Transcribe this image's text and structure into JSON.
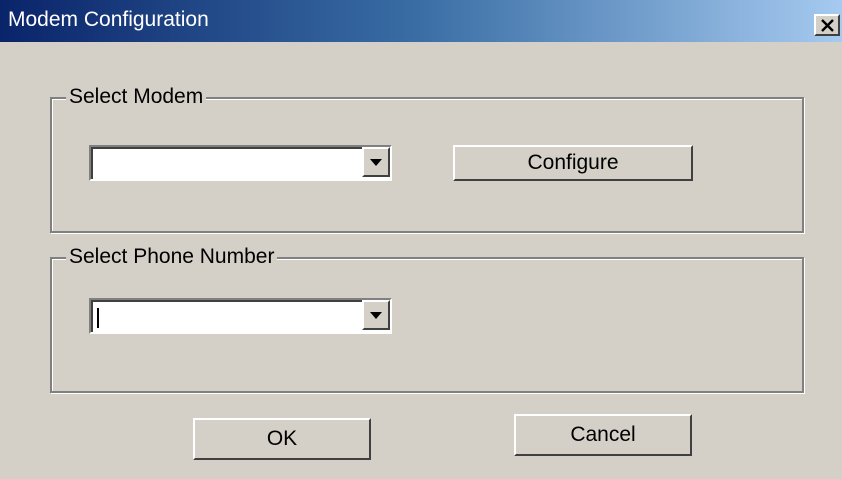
{
  "window": {
    "title": "Modem Configuration"
  },
  "titlebar": {
    "close_symbol": "×"
  },
  "modem_group": {
    "legend": "Select Modem",
    "combo_value": "",
    "configure_label": "Configure"
  },
  "phone_group": {
    "legend": "Select Phone Number",
    "combo_value": ""
  },
  "buttons": {
    "ok_label": "OK",
    "cancel_label": "Cancel"
  },
  "colors": {
    "face": "#d4d0c8",
    "title_start": "#0a246a",
    "title_end": "#a6caf0"
  },
  "icons": {
    "close": "close-icon",
    "dropdown": "chevron-down-icon"
  }
}
